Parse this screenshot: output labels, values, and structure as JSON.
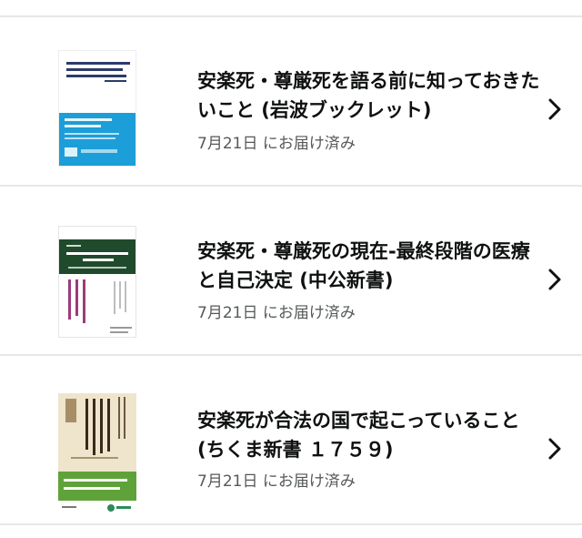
{
  "orders": [
    {
      "title": "安楽死・尊厳死を語る前に知っておきたいこと (岩波ブックレット)",
      "status": "7月21日 にお届け済み",
      "cover_colors": {
        "accent": "#1c9ed8"
      },
      "chevron_icon": "chevron-right-icon"
    },
    {
      "title": "安楽死・尊厳死の現在-最終段階の医療と自己決定 (中公新書)",
      "status": "7月21日 にお届け済み",
      "cover_colors": {
        "accent": "#1f4a2c"
      },
      "chevron_icon": "chevron-right-icon"
    },
    {
      "title": "安楽死が合法の国で起こっていること (ちくま新書 １７５９)",
      "status": "7月21日 にお届け済み",
      "cover_colors": {
        "accent": "#5fa23a"
      },
      "chevron_icon": "chevron-right-icon"
    }
  ]
}
